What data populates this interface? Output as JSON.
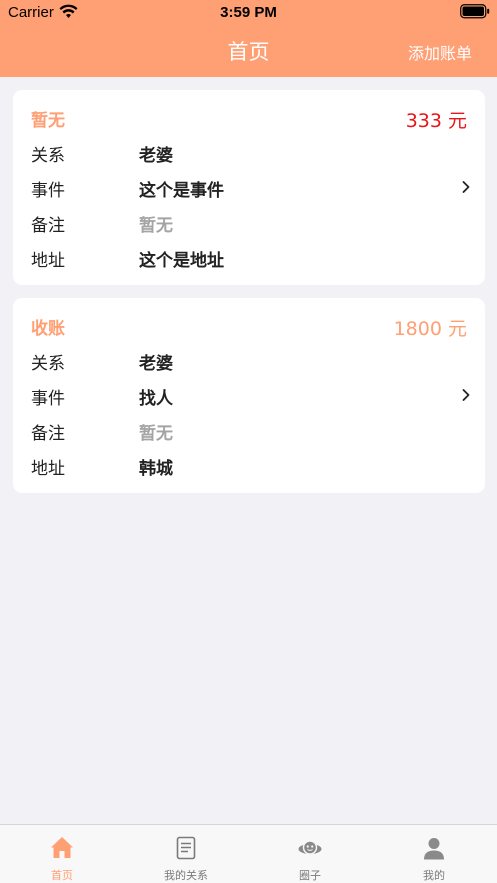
{
  "status_bar": {
    "carrier": "Carrier",
    "time": "3:59 PM"
  },
  "nav": {
    "title": "首页",
    "action": "添加账单"
  },
  "bills": [
    {
      "title": "暂无",
      "amount": "333 元",
      "amount_color": "#e8151b",
      "rows": [
        {
          "label": "关系",
          "value": "老婆"
        },
        {
          "label": "事件",
          "value": "这个是事件"
        },
        {
          "label": "备注",
          "value": "暂无"
        },
        {
          "label": "地址",
          "value": "这个是地址"
        }
      ]
    },
    {
      "title": "收账",
      "amount": "1800 元",
      "amount_color": "#ff9f74",
      "rows": [
        {
          "label": "关系",
          "value": "老婆"
        },
        {
          "label": "事件",
          "value": "找人"
        },
        {
          "label": "备注",
          "value": "暂无"
        },
        {
          "label": "地址",
          "value": "韩城"
        }
      ]
    }
  ],
  "tabs": [
    {
      "label": "首页",
      "icon": "home-icon",
      "active": true
    },
    {
      "label": "我的关系",
      "icon": "document-icon",
      "active": false
    },
    {
      "label": "圈子",
      "icon": "planet-icon",
      "active": false
    },
    {
      "label": "我的",
      "icon": "person-icon",
      "active": false
    }
  ],
  "colors": {
    "accent": "#ff9f74",
    "background": "#f2f1f6",
    "muted_text": "#a4a4a4"
  }
}
